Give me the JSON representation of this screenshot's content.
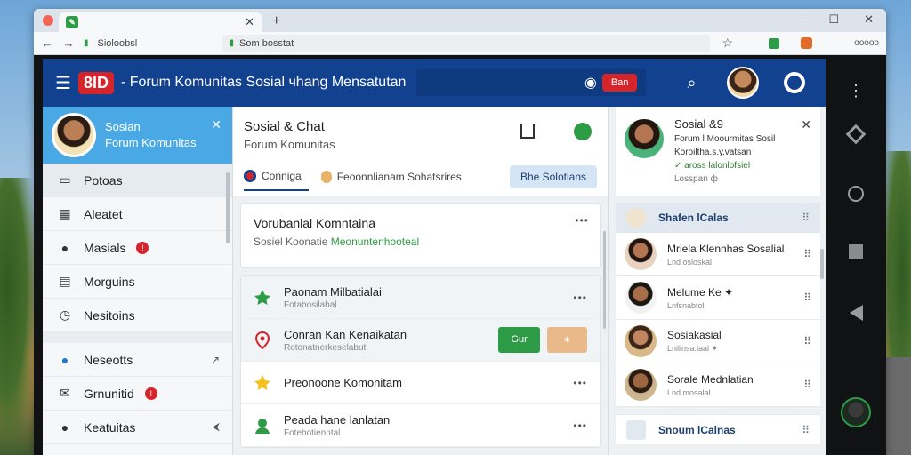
{
  "browser": {
    "tab_title": "",
    "address_left": "Sioloobsl",
    "address": "Som bosstat",
    "right_text": "ooooo"
  },
  "app": {
    "logo": "8ID",
    "title": "- Forum Komunitas Sosial чhang Mensatutan",
    "live_badge": "Ban"
  },
  "sidebar": {
    "user_name": "Sosian",
    "user_sub": "Forum Komunitas",
    "items": [
      {
        "label": "Potoas",
        "icon": "folder-icon",
        "active": true
      },
      {
        "label": "Aleatet",
        "icon": "calendar-icon"
      },
      {
        "label": "Masials",
        "icon": "circle-icon",
        "badge": "!"
      },
      {
        "label": "Morguins",
        "icon": "doc-icon"
      },
      {
        "label": "Nesitoins",
        "icon": "clock-icon"
      },
      {
        "label": "Neseotts",
        "icon": "chat-icon",
        "extra": "↗"
      },
      {
        "label": "Grnunitid",
        "icon": "mail-icon",
        "badge": "!"
      },
      {
        "label": "Keatuitas",
        "icon": "pin-icon",
        "extra": "⮜"
      }
    ]
  },
  "feed": {
    "title": "Sosial & Chat",
    "subtitle": "Forum Komunitas",
    "tabs": [
      {
        "label": "Conniga",
        "active": true
      },
      {
        "label": "Feoonnlianam Sohatsrires"
      },
      {
        "label": "Bhe Solotians",
        "chip": true
      }
    ],
    "highlight": {
      "title": "Vorubanlal Komntaina",
      "desc_prefix": "Sosiel Koonatie",
      "desc_highlight": "Meonuntenhooteal"
    },
    "posts": [
      {
        "title": "Paonam Milbatialai",
        "sub": "Fotabosilabal",
        "icon_color": "#2e9c47"
      },
      {
        "title": "Conran Kan Kenaikatan",
        "sub": "Rotonatnerkeselabut",
        "icon_color": "#d5252b",
        "btn1": "Gur",
        "btn2": "✶"
      },
      {
        "title": "Preonoone Komonitam",
        "sub": "",
        "icon_color": "#f2c21b"
      },
      {
        "title": "Peada hane lanlatan",
        "sub": "Fotebotienntal",
        "icon_color": "#2e9c47"
      }
    ]
  },
  "rpanel": {
    "name": "Sosial &9",
    "line1": "Forum l Moourmitas Sosil",
    "line2": "Koroiltha.s.у.vatsan",
    "line3": "✓ aross lalonlofsiel",
    "line4": "Losspan ф",
    "section1": "Shafen lCalas",
    "section2": "Snoum lCalnas",
    "friends": [
      {
        "name": "Mriela Klennhas Sosalial",
        "sub": "Lnd osloskal"
      },
      {
        "name": "Melume Ke ✦",
        "sub": "Lnfsnabtol"
      },
      {
        "name": "Sosiakasial",
        "sub": "Lnilinsa.laal ✦"
      },
      {
        "name": "Sorale Mednlatian",
        "sub": "Lnd.mosalal"
      }
    ]
  },
  "colors": {
    "topbar": "#12418f",
    "accent_red": "#d5252b",
    "accent_green": "#2e9c47",
    "sidebar_header": "#4aa8e4"
  }
}
